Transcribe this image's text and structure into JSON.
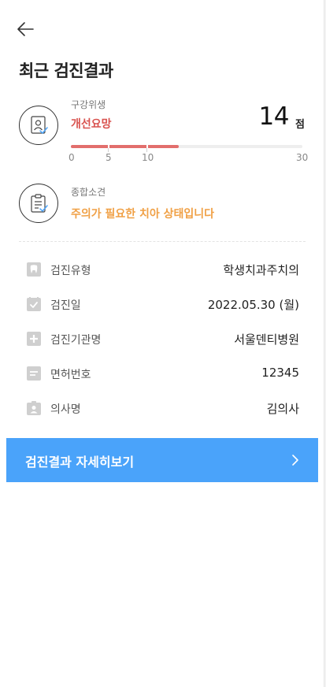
{
  "page": {
    "title": "최근 검진결과"
  },
  "oral_hygiene": {
    "label": "구강위생",
    "status": "개선요망",
    "score": "14",
    "score_unit": "점",
    "score_value": 14,
    "score_max": 30,
    "status_color": "#d9534f",
    "ticks": [
      "0",
      "5",
      "10",
      "30"
    ]
  },
  "overall": {
    "label": "종합소견",
    "opinion": "주의가 필요한 치아 상태입니다",
    "opinion_color": "#f0a045"
  },
  "info": [
    {
      "icon": "tooth-icon",
      "label": "검진유형",
      "value": "학생치과주치의"
    },
    {
      "icon": "calendar-check-icon",
      "label": "검진일",
      "value": "2022.05.30 (월)"
    },
    {
      "icon": "hospital-plus-icon",
      "label": "검진기관명",
      "value": "서울덴티병원"
    },
    {
      "icon": "license-card-icon",
      "label": "면허번호",
      "value": "12345"
    },
    {
      "icon": "doctor-badge-icon",
      "label": "의사명",
      "value": "김의사"
    }
  ],
  "detail_button": {
    "label": "검진결과 자세히보기",
    "color": "#4aa3fa"
  }
}
